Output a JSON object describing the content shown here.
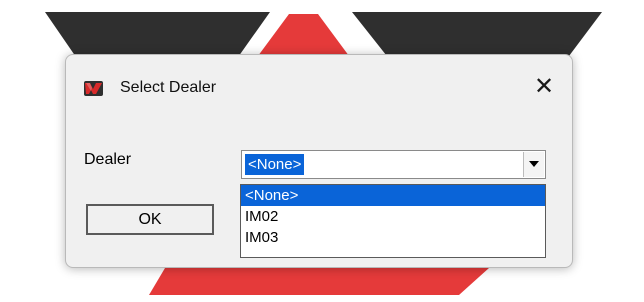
{
  "window": {
    "title": "Select Dealer",
    "close_glyph": "✕",
    "icon": "app-logo-icon"
  },
  "form": {
    "dealer_label": "Dealer",
    "selected_value": "<None>",
    "options": [
      "<None>",
      "IM02",
      "IM03"
    ],
    "ok_label": "OK"
  },
  "colors": {
    "dialog_bg": "#f0f0f0",
    "selection_blue": "#0a64d8",
    "logo_dark": "#2f2f2f",
    "logo_red": "#e53a3a"
  }
}
